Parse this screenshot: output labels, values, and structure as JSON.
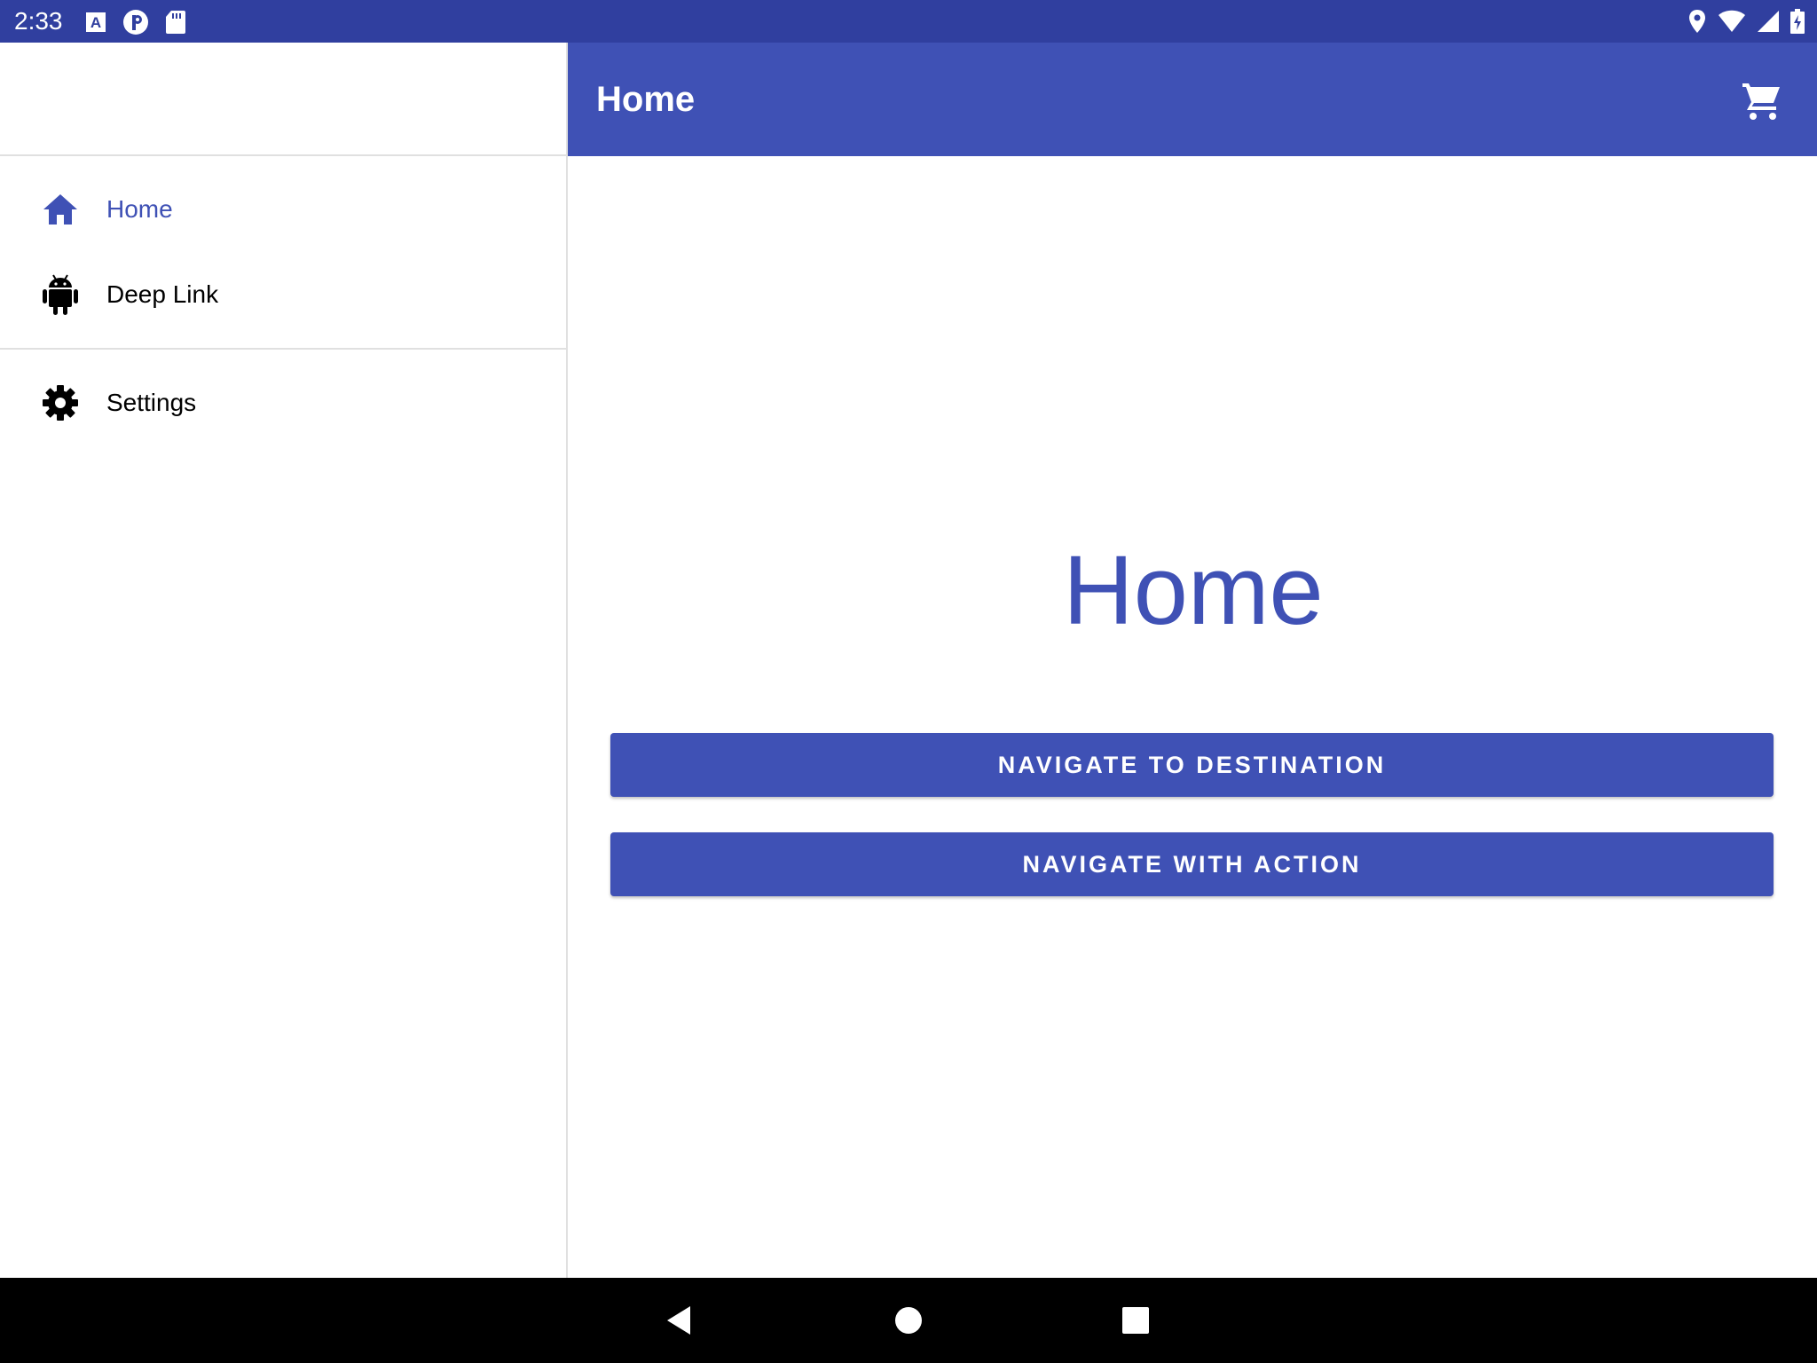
{
  "status_bar": {
    "time": "2:33",
    "left_icons": [
      "a-notification-icon",
      "pinterest-icon",
      "sd-card-icon"
    ],
    "right_icons": [
      "location-icon",
      "wifi-icon",
      "signal-icon",
      "battery-charging-icon"
    ]
  },
  "drawer": {
    "groups": [
      {
        "items": [
          {
            "label": "Home",
            "icon": "home-icon",
            "active": true
          },
          {
            "label": "Deep Link",
            "icon": "android-icon",
            "active": false
          }
        ]
      },
      {
        "items": [
          {
            "label": "Settings",
            "icon": "gear-icon",
            "active": false
          }
        ]
      }
    ]
  },
  "app_bar": {
    "title": "Home",
    "action_icon": "cart-icon"
  },
  "main": {
    "heading": "Home",
    "buttons": [
      {
        "label": "NAVIGATE TO DESTINATION"
      },
      {
        "label": "NAVIGATE WITH ACTION"
      }
    ]
  },
  "nav_bar": {
    "keys": [
      "back-icon",
      "home-circle-icon",
      "recents-icon"
    ]
  },
  "colors": {
    "primary": "#3f51b5",
    "primary_dark": "#303f9f",
    "text": "#000000",
    "divider": "#e0e0e0"
  }
}
